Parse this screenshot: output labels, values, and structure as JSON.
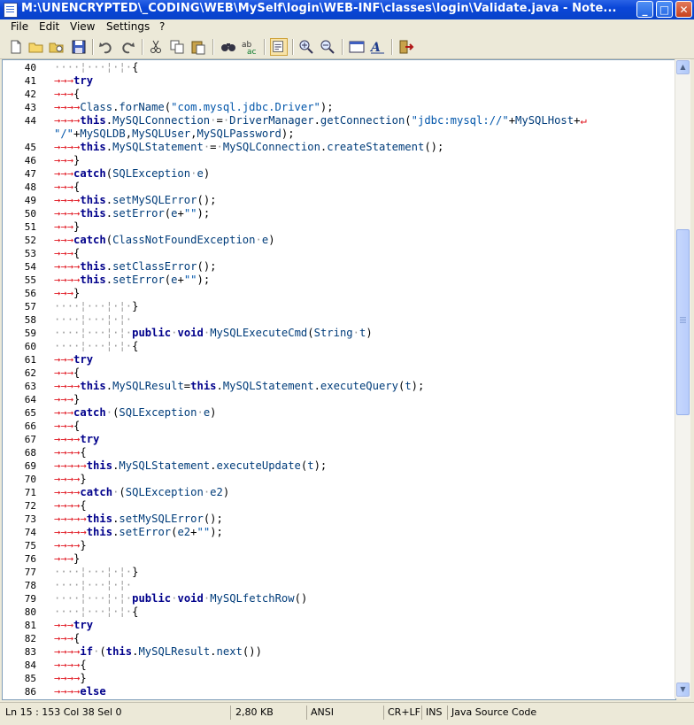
{
  "window": {
    "title": "M:\\UNENCRYPTED\\_CODING\\WEB\\MySelf\\login\\WEB-INF\\classes\\login\\Validate.java - Note...",
    "minimize": "_",
    "maximize": "□",
    "close": "✕"
  },
  "menu": [
    "File",
    "Edit",
    "View",
    "Settings",
    "?"
  ],
  "toolbar": {
    "icons": [
      "new-file-icon",
      "open-file-icon",
      "open-favorites-icon",
      "save-icon",
      "undo-icon",
      "redo-icon",
      "cut-icon",
      "copy-icon",
      "paste-icon",
      "find-icon",
      "replace-icon",
      "word-wrap-icon",
      "zoom-in-icon",
      "zoom-out-icon",
      "view-icon",
      "font-icon",
      "exit-icon"
    ]
  },
  "editor": {
    "lines": [
      {
        "n": "40",
        "t": "····¦···¦·¦·{"
      },
      {
        "n": "41",
        "t": "→→→try"
      },
      {
        "n": "42",
        "t": "→→→{"
      },
      {
        "n": "43",
        "t": "→→→→Class.forName(\"com.mysql.jdbc.Driver\");"
      },
      {
        "n": "44",
        "t": "→→→→this.MySQLConnection·=·DriverManager.getConnection(\"jdbc:mysql://\"+MySQLHost+↵"
      },
      {
        "n": "",
        "t": "\"/\"+MySQLDB,MySQLUser,MySQLPassword);"
      },
      {
        "n": "45",
        "t": "→→→→this.MySQLStatement·=·MySQLConnection.createStatement();"
      },
      {
        "n": "46",
        "t": "→→→}"
      },
      {
        "n": "47",
        "t": "→→→catch(SQLException·e)"
      },
      {
        "n": "48",
        "t": "→→→{"
      },
      {
        "n": "49",
        "t": "→→→→this.setMySQLError();"
      },
      {
        "n": "50",
        "t": "→→→→this.setError(e+\"\");"
      },
      {
        "n": "51",
        "t": "→→→}"
      },
      {
        "n": "52",
        "t": "→→→catch(ClassNotFoundException·e)"
      },
      {
        "n": "53",
        "t": "→→→{"
      },
      {
        "n": "54",
        "t": "→→→→this.setClassError();"
      },
      {
        "n": "55",
        "t": "→→→→this.setError(e+\"\");"
      },
      {
        "n": "56",
        "t": "→→→}"
      },
      {
        "n": "57",
        "t": "····¦···¦·¦·}"
      },
      {
        "n": "58",
        "t": "····¦···¦·¦·"
      },
      {
        "n": "59",
        "t": "····¦···¦·¦·public·void·MySQLExecuteCmd(String·t)"
      },
      {
        "n": "60",
        "t": "····¦···¦·¦·{"
      },
      {
        "n": "61",
        "t": "→→→try"
      },
      {
        "n": "62",
        "t": "→→→{"
      },
      {
        "n": "63",
        "t": "→→→→this.MySQLResult=this.MySQLStatement.executeQuery(t);"
      },
      {
        "n": "64",
        "t": "→→→}"
      },
      {
        "n": "65",
        "t": "→→→catch·(SQLException·e)"
      },
      {
        "n": "66",
        "t": "→→→{"
      },
      {
        "n": "67",
        "t": "→→→→try"
      },
      {
        "n": "68",
        "t": "→→→→{"
      },
      {
        "n": "69",
        "t": "→→→→→this.MySQLStatement.executeUpdate(t);"
      },
      {
        "n": "70",
        "t": "→→→→}"
      },
      {
        "n": "71",
        "t": "→→→→catch·(SQLException·e2)"
      },
      {
        "n": "72",
        "t": "→→→→{"
      },
      {
        "n": "73",
        "t": "→→→→→this.setMySQLError();"
      },
      {
        "n": "74",
        "t": "→→→→→this.setError(e2+\"\");"
      },
      {
        "n": "75",
        "t": "→→→→}"
      },
      {
        "n": "76",
        "t": "→→→}"
      },
      {
        "n": "77",
        "t": "····¦···¦·¦·}"
      },
      {
        "n": "78",
        "t": "····¦···¦·¦·"
      },
      {
        "n": "79",
        "t": "····¦···¦·¦·public·void·MySQLfetchRow()"
      },
      {
        "n": "80",
        "t": "····¦···¦·¦·{"
      },
      {
        "n": "81",
        "t": "→→→try"
      },
      {
        "n": "82",
        "t": "→→→{"
      },
      {
        "n": "83",
        "t": "→→→→if·(this.MySQLResult.next())"
      },
      {
        "n": "84",
        "t": "→→→→{"
      },
      {
        "n": "85",
        "t": "→→→→}"
      },
      {
        "n": "86",
        "t": "→→→→else"
      }
    ]
  },
  "status": {
    "position": "Ln 15 : 153   Col 38   Sel 0",
    "size": "2,80 KB",
    "encoding": "ANSI",
    "eol": "CR+LF",
    "mode": "INS",
    "syntax": "Java Source Code"
  }
}
